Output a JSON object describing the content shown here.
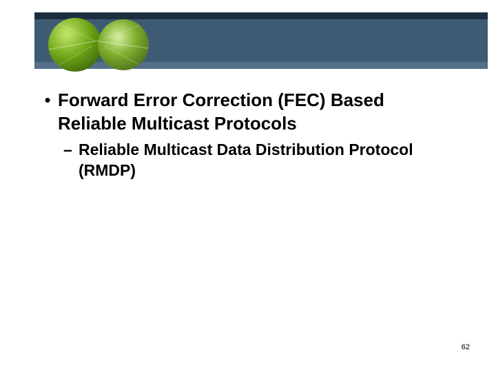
{
  "colors": {
    "banner_bg": "#3d5c74",
    "banner_top": "#1d2e3f",
    "banner_bottom": "#54708a"
  },
  "bullets": {
    "main": {
      "marker": "•",
      "text": "Forward Error Correction (FEC) Based Reliable Multicast Protocols"
    },
    "sub": {
      "marker": "–",
      "text": "Reliable Multicast Data Distribution Protocol (RMDP)"
    }
  },
  "page_number": "62"
}
